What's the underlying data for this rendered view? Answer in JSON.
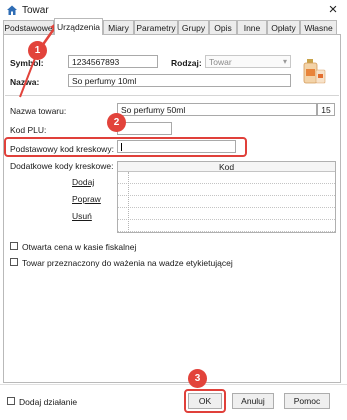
{
  "window": {
    "title": "Towar",
    "close_icon": "×"
  },
  "tabs": [
    {
      "label": "Podstawowe"
    },
    {
      "label": "Urządzenia"
    },
    {
      "label": "Miary"
    },
    {
      "label": "Parametry"
    },
    {
      "label": "Grupy"
    },
    {
      "label": "Opis"
    },
    {
      "label": "Inne"
    },
    {
      "label": "Opłaty"
    },
    {
      "label": "Własne"
    }
  ],
  "header": {
    "symbol_label": "Symbol:",
    "symbol_value": "1234567893",
    "rodzaj_label": "Rodzaj:",
    "rodzaj_value": "Towar",
    "nazwa_label": "Nazwa:",
    "nazwa_value": "So perfumy 10ml"
  },
  "device": {
    "nazwa_towaru_label": "Nazwa towaru:",
    "nazwa_towaru_value": "So perfumy 50ml",
    "nazwa_length": "15",
    "kod_plu_label": "Kod PLU:",
    "kod_plu_value": "",
    "barcode_label": "Podstawowy kod kreskowy:",
    "barcode_value": "",
    "additional_label": "Dodatkowe kody kreskowe:",
    "actions": {
      "add": "Dodaj",
      "edit": "Popraw",
      "remove": "Usuń"
    },
    "grid_header": "Kod"
  },
  "checkboxes": {
    "open_price": "Otwarta cena w kasie fiskalnej",
    "weighing": "Towar przeznaczony do ważenia na wadze etykietującej"
  },
  "footer": {
    "add_action": "Dodaj działanie",
    "ok": "OK",
    "cancel": "Anuluj",
    "help": "Pomoc"
  },
  "annotations": {
    "badge1": "1",
    "badge2": "2",
    "badge3": "3",
    "color": "#e2433b"
  }
}
